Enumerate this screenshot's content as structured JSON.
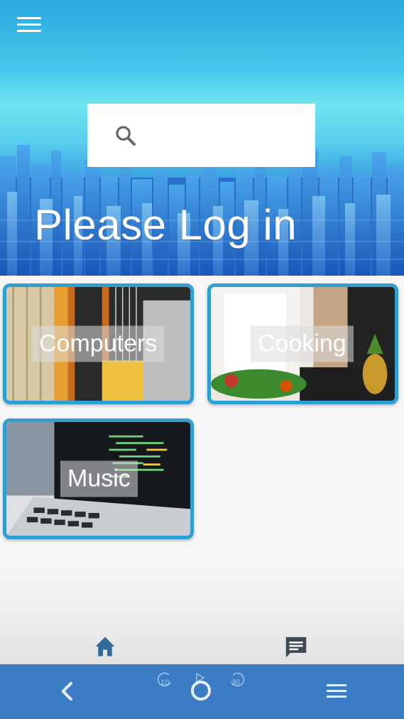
{
  "header": {
    "menu_icon": "hamburger-menu-icon",
    "search": {
      "icon": "search-icon",
      "placeholder": "",
      "value": ""
    },
    "title": "Please Log in"
  },
  "categories": [
    {
      "label": "Computers",
      "image": "guitar-photo"
    },
    {
      "label": "Cooking",
      "image": "chefs-vegetables-photo"
    },
    {
      "label": "Music",
      "image": "laptop-photo"
    }
  ],
  "tab_bar": {
    "items": [
      {
        "icon": "home-icon",
        "active": true
      },
      {
        "icon": "chat-icon",
        "active": false
      }
    ]
  },
  "system_nav": {
    "back_icon": "back-chevron-icon",
    "home_icon": "circle-home-icon",
    "menu_icon": "menu-lines-icon",
    "rewind_label": "10",
    "forward_label": "30"
  },
  "colors": {
    "accent": "#2e9fd2",
    "nav_bar": "#3b7cc4",
    "tab_icon": "#2f6a9a",
    "chat_icon": "#3d4a55"
  }
}
